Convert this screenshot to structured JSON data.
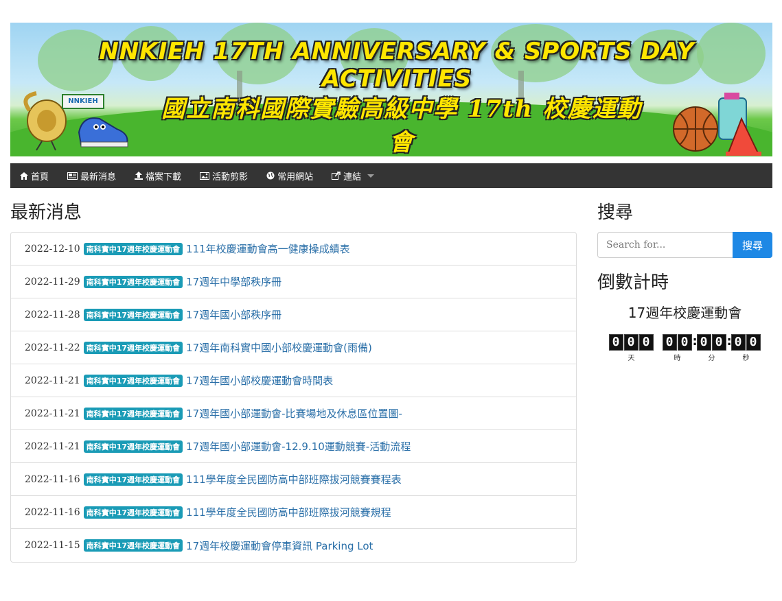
{
  "banner": {
    "title": "NNKIEH  17TH ANNIVERSARY & SPORTS DAY ACTIVITIES",
    "subtitle": "國立南科國際實驗高級中學 17th 校慶運動會",
    "sign": "NNKIEH"
  },
  "nav": {
    "items": [
      {
        "label": "首頁",
        "icon": "home-icon"
      },
      {
        "label": "最新消息",
        "icon": "newspaper-icon"
      },
      {
        "label": "檔案下載",
        "icon": "upload-icon"
      },
      {
        "label": "活動剪影",
        "icon": "image-icon"
      },
      {
        "label": "常用網站",
        "icon": "globe-icon"
      },
      {
        "label": "連結",
        "icon": "share-icon"
      }
    ]
  },
  "news": {
    "heading": "最新消息",
    "items": [
      {
        "date": "2022-12-10",
        "tag": "南科實中17週年校慶運動會",
        "title": "111年校慶運動會高一健康操成績表"
      },
      {
        "date": "2022-11-29",
        "tag": "南科實中17週年校慶運動會",
        "title": "17週年中學部秩序冊"
      },
      {
        "date": "2022-11-28",
        "tag": "南科實中17週年校慶運動會",
        "title": "17週年國小部秩序冊"
      },
      {
        "date": "2022-11-22",
        "tag": "南科實中17週年校慶運動會",
        "title": "17週年南科實中國小部校慶運動會(雨備)"
      },
      {
        "date": "2022-11-21",
        "tag": "南科實中17週年校慶運動會",
        "title": "17週年國小部校慶運動會時間表"
      },
      {
        "date": "2022-11-21",
        "tag": "南科實中17週年校慶運動會",
        "title": "17週年國小部運動會-比賽場地及休息區位置圖-"
      },
      {
        "date": "2022-11-21",
        "tag": "南科實中17週年校慶運動會",
        "title": "17週年國小部運動會-12.9.10運動競賽-活動流程"
      },
      {
        "date": "2022-11-16",
        "tag": "南科實中17週年校慶運動會",
        "title": "111學年度全民國防高中部班際拔河競賽賽程表"
      },
      {
        "date": "2022-11-16",
        "tag": "南科實中17週年校慶運動會",
        "title": "111學年度全民國防高中部班際拔河競賽規程"
      },
      {
        "date": "2022-11-15",
        "tag": "南科實中17週年校慶運動會",
        "title": "17週年校慶運動會停車資訊 Parking Lot"
      }
    ]
  },
  "sidebar": {
    "search_heading": "搜尋",
    "search_placeholder": "Search for...",
    "search_button": "搜尋",
    "countdown_heading": "倒數計時",
    "event_name": "17週年校慶運動會",
    "countdown": {
      "days": [
        "0",
        "0",
        "0"
      ],
      "hours": [
        "0",
        "0"
      ],
      "minutes": [
        "0",
        "0"
      ],
      "seconds": [
        "0",
        "0"
      ],
      "labels": {
        "days": "天",
        "hours": "時",
        "minutes": "分",
        "seconds": "秒"
      }
    }
  },
  "colors": {
    "navbar": "#343434",
    "badge": "#1a9bb6",
    "link": "#2a6fa8",
    "button": "#1e88e5",
    "title_yellow": "#ffe600"
  }
}
